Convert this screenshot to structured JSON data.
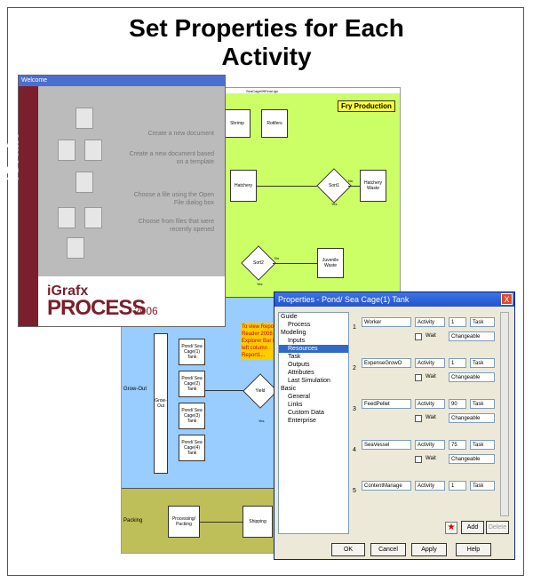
{
  "slide": {
    "title_line1": "Set Properties for Each",
    "title_line2": "Activity"
  },
  "flowchart": {
    "file_label": "SeaCage09Final.igx",
    "fry_label": "Fry Production",
    "shapes": {
      "shrimp": "Shrimp",
      "rotifers": "Rotifers",
      "hatchery": "Hatchery",
      "sort1": "Sort1",
      "hatchery_waste": "Hatchery Waste",
      "sort2": "Sort2",
      "juvenile_waste": "Juvenile Waste",
      "grow_out_bar": "Grow-Out",
      "pond1": "Pond/ Sea Cage(1) Tank",
      "pond2": "Pond/ Sea Cage(2) Tank",
      "pond3": "Pond/ Sea Cage(3) Tank",
      "pond4": "Pond/ Sea Cage(4) Tank",
      "yield": "Yield",
      "processing": "Processing/ Packing",
      "shipping": "Shipping"
    },
    "edge_labels": {
      "no": "No",
      "yes": "Yes"
    },
    "lanes": {
      "grow_out": "Grow-Out",
      "packing": "Packing"
    },
    "note": "To view Report Reader 2008 Explorer Bar for left column Report1..."
  },
  "welcome": {
    "title": "Welcome",
    "brand_side": "iGrafx",
    "links": [
      "Create a new document",
      "Create a new document based on a template",
      "Choose a file using the Open File dialog box",
      "Choose from files that were recently opened"
    ],
    "footer_brand": "iGrafx",
    "footer_product": "PROCESS",
    "footer_year": "2006"
  },
  "dialog": {
    "title": "Properties - Pond/ Sea Cage(1) Tank",
    "close_glyph": "X",
    "tree": [
      {
        "label": "Guide",
        "indent": 0,
        "selected": false
      },
      {
        "label": "Process",
        "indent": 1,
        "selected": false
      },
      {
        "label": "Modeling",
        "indent": 0,
        "selected": false
      },
      {
        "label": "Inputs",
        "indent": 1,
        "selected": false
      },
      {
        "label": "Resources",
        "indent": 1,
        "selected": true
      },
      {
        "label": "Task",
        "indent": 1,
        "selected": false
      },
      {
        "label": "Outputs",
        "indent": 1,
        "selected": false
      },
      {
        "label": "Attributes",
        "indent": 1,
        "selected": false
      },
      {
        "label": "Last Simulation",
        "indent": 1,
        "selected": false
      },
      {
        "label": "Basic",
        "indent": 0,
        "selected": false
      },
      {
        "label": "General",
        "indent": 1,
        "selected": false
      },
      {
        "label": "Links",
        "indent": 1,
        "selected": false
      },
      {
        "label": "Custom Data",
        "indent": 1,
        "selected": false
      },
      {
        "label": "Enterprise",
        "indent": 1,
        "selected": false
      }
    ],
    "rows": [
      {
        "num": "1",
        "resource": "Worker",
        "scope": "Activity",
        "qty": "1",
        "unit": "Task",
        "wait": "Wait",
        "mode": "Changeable"
      },
      {
        "num": "2",
        "resource": "ExpenseGrowO",
        "scope": "Activity",
        "qty": "1",
        "unit": "Task",
        "wait": "Wait",
        "mode": "Changeable"
      },
      {
        "num": "3",
        "resource": "FeedPellet",
        "scope": "Activity",
        "qty": "90",
        "unit": "Task",
        "wait": "Wait",
        "mode": "Changeable"
      },
      {
        "num": "4",
        "resource": "SeaVessel",
        "scope": "Activity",
        "qty": "75",
        "unit": "Task",
        "wait": "Wait",
        "mode": "Changeable"
      },
      {
        "num": "5",
        "resource": "ContentManage",
        "scope": "Activity",
        "qty": "1",
        "unit": "Task",
        "wait": "",
        "mode": ""
      }
    ],
    "buttons": {
      "add": "Add",
      "delete": "Delete",
      "ok": "OK",
      "cancel": "Cancel",
      "apply": "Apply",
      "help": "Help"
    }
  }
}
